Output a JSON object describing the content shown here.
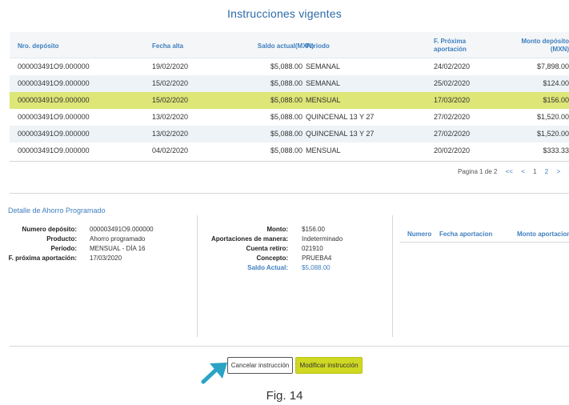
{
  "page": {
    "title": "Instrucciones vigentes",
    "caption": "Fig. 14"
  },
  "table": {
    "headers": {
      "deposito": "Nro. depósito",
      "fecha_alta": "Fecha alta",
      "saldo": "Saldo actual(MXN)",
      "periodo": "Periodo",
      "proxima_1": "F. Próxima",
      "proxima_2": "aportación",
      "monto_1": "Monto depósito",
      "monto_2": "(MXN)"
    },
    "rows": [
      {
        "deposito": "000003491O9.000000",
        "fecha_alta": "19/02/2020",
        "saldo": "$5,088.00",
        "periodo": "SEMANAL",
        "proxima": "24/02/2020",
        "monto": "$7,898.00",
        "selected": false
      },
      {
        "deposito": "000003491O9.000000",
        "fecha_alta": "15/02/2020",
        "saldo": "$5,088.00",
        "periodo": "SEMANAL",
        "proxima": "25/02/2020",
        "monto": "$124.00",
        "selected": false
      },
      {
        "deposito": "000003491O9.000000",
        "fecha_alta": "15/02/2020",
        "saldo": "$5,088.00",
        "periodo": "MENSUAL",
        "proxima": "17/03/2020",
        "monto": "$156.00",
        "selected": true
      },
      {
        "deposito": "000003491O9.000000",
        "fecha_alta": "13/02/2020",
        "saldo": "$5,088.00",
        "periodo": "QUINCENAL 13 Y 27",
        "proxima": "27/02/2020",
        "monto": "$1,520.00",
        "selected": false
      },
      {
        "deposito": "000003491O9.000000",
        "fecha_alta": "13/02/2020",
        "saldo": "$5,088.00",
        "periodo": "QUINCENAL 13 Y 27",
        "proxima": "27/02/2020",
        "monto": "$1,520.00",
        "selected": false
      },
      {
        "deposito": "000003491O9.000000",
        "fecha_alta": "04/02/2020",
        "saldo": "$5,088.00",
        "periodo": "MENSUAL",
        "proxima": "20/02/2020",
        "monto": "$333.33",
        "selected": false
      }
    ]
  },
  "pagination": {
    "label": "Pagina 1 de 2",
    "first": "<<",
    "prev": "<",
    "page1": "1",
    "page2": "2",
    "next": ">",
    "last": ">>"
  },
  "detail": {
    "title": "Detalle de Ahorro Programado",
    "left": {
      "numero_label": "Numero depósito:",
      "numero_value": "000003491O9.000000",
      "producto_label": "Producto:",
      "producto_value": "Ahorro programado",
      "periodo_label": "Periodo:",
      "periodo_value": "MENSUAL - DÍA 16",
      "proxima_label": "F. próxima aportación:",
      "proxima_value": "17/03/2020"
    },
    "middle": {
      "monto_label": "Monto:",
      "monto_value": "$156.00",
      "aportaciones_label": "Aportaciones de manera:",
      "aportaciones_value": "Indeterminado",
      "cuenta_label": "Cuenta retiro:",
      "cuenta_value": "021910",
      "concepto_label": "Concepto:",
      "concepto_value": "PRUEBA4",
      "saldo_label": "Saldo Actual:",
      "saldo_value": "$5,088.00"
    },
    "right": {
      "col_numero": "Numero",
      "col_fecha": "Fecha aportacion",
      "col_monto": "Monto aportacion"
    }
  },
  "buttons": {
    "cancel": "Cancelar instrucción",
    "modify": "Modificar instrucción"
  },
  "colors": {
    "accent": "#3f7fbf",
    "highlight": "#dde677",
    "primary_button": "#cfd822",
    "arrow": "#2aa3c6"
  }
}
